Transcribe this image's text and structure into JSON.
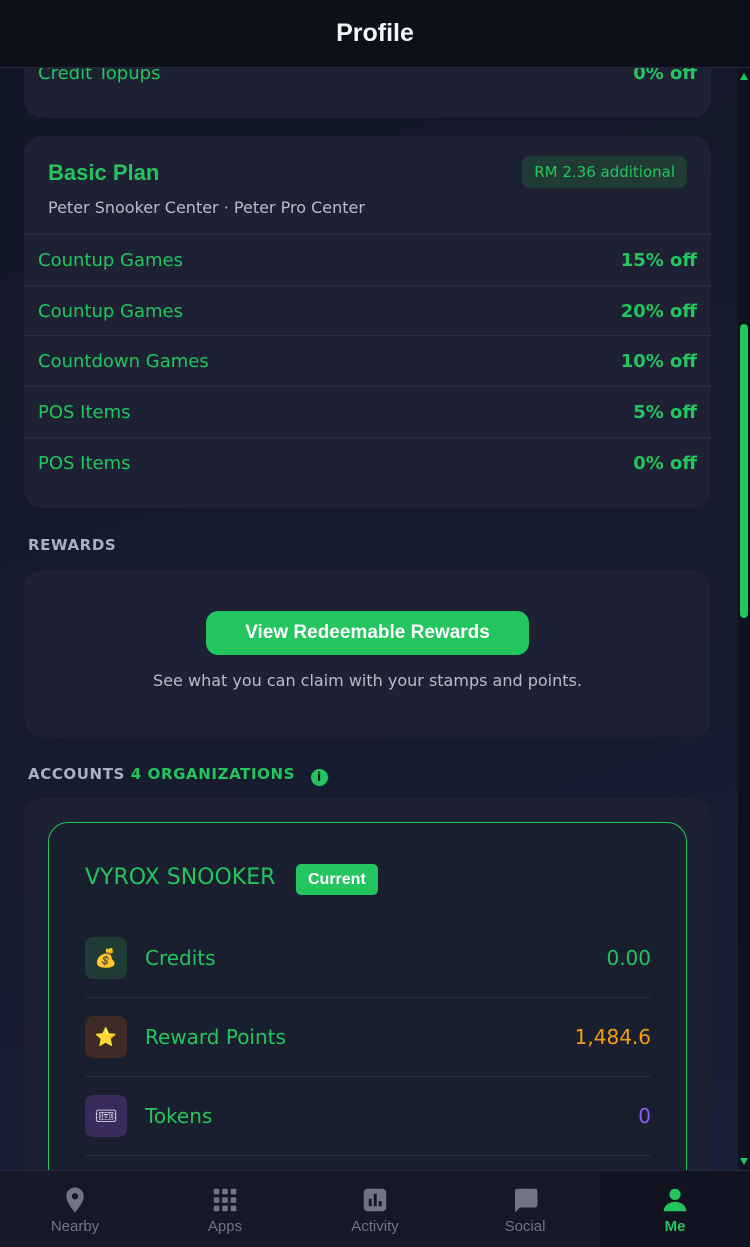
{
  "header": {
    "title": "Profile"
  },
  "credit_topups_row": {
    "label": "Credit Topups",
    "value": "0% off"
  },
  "plan": {
    "title": "Basic Plan",
    "badge": "RM 2.36 additional",
    "subtitle": "Peter Snooker Center · Peter Pro Center",
    "rows": [
      {
        "label": "Countup Games",
        "value": "15% off"
      },
      {
        "label": "Countup Games",
        "value": "20% off"
      },
      {
        "label": "Countdown Games",
        "value": "10% off"
      },
      {
        "label": "POS Items",
        "value": "5% off"
      },
      {
        "label": "POS Items",
        "value": "0% off"
      }
    ]
  },
  "rewards": {
    "section_label": "REWARDS",
    "button_label": "View Redeemable Rewards",
    "note": "See what you can claim with your stamps and points."
  },
  "accounts": {
    "section_label": "ACCOUNTS",
    "org_count": "4 ORGANIZATIONS",
    "info_icon": "i",
    "org": {
      "name": "VYROX SNOOKER",
      "badge": "Current",
      "items": [
        {
          "icon": "money-bag-icon",
          "glyph": "💰",
          "label": "Credits",
          "value": "0.00",
          "value_color": "#22c55e",
          "icon_bg": "#1f3b33"
        },
        {
          "icon": "star-icon",
          "glyph": "⭐",
          "label": "Reward Points",
          "value": "1,484.6",
          "value_color": "#f59e0b",
          "icon_bg": "#3d2a24"
        },
        {
          "icon": "ticket-icon",
          "glyph": "🎟",
          "label": "Tokens",
          "value": "0",
          "value_color": "#8b5cf6",
          "icon_bg": "#3a2b5c"
        }
      ]
    }
  },
  "nav": {
    "items": [
      {
        "label": "Nearby",
        "icon": "location-pin-icon"
      },
      {
        "label": "Apps",
        "icon": "grid-icon"
      },
      {
        "label": "Activity",
        "icon": "bar-chart-icon"
      },
      {
        "label": "Social",
        "icon": "chat-bubble-icon"
      },
      {
        "label": "Me",
        "icon": "person-icon",
        "active": true
      }
    ]
  },
  "colors": {
    "accent": "#22c55e",
    "background": "#161b2e",
    "card": "#1d2133"
  }
}
